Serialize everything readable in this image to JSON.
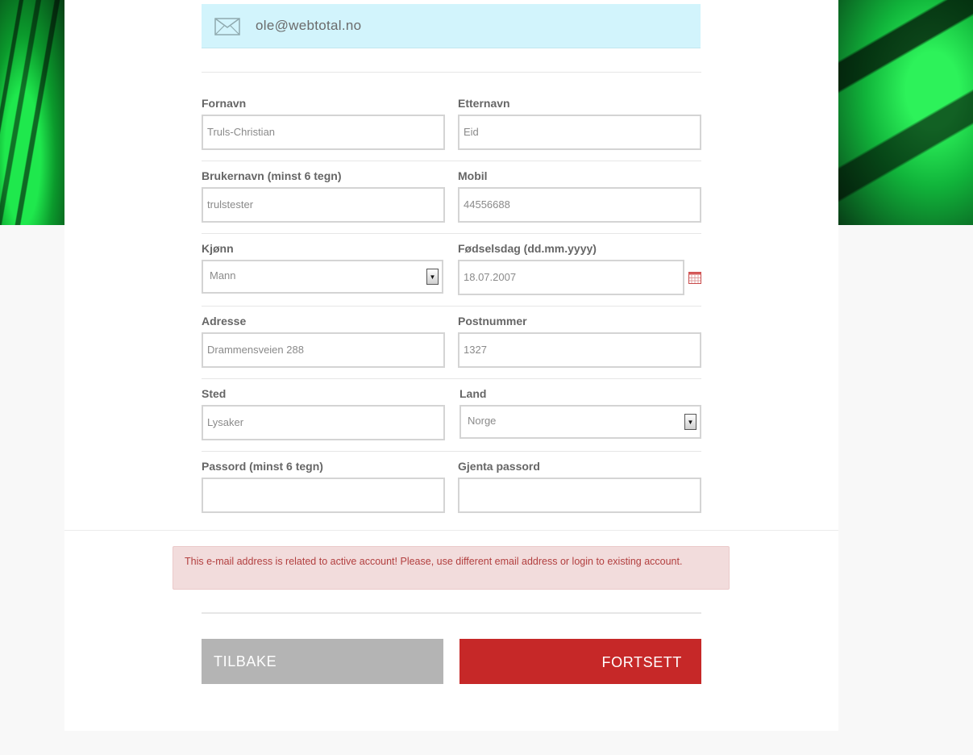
{
  "email": {
    "value": "ole@webtotal.no",
    "icon": "envelope-icon"
  },
  "fields": {
    "fornavn": {
      "label": "Fornavn",
      "value": "Truls-Christian"
    },
    "etternavn": {
      "label": "Etternavn",
      "value": "Eid"
    },
    "brukernavn": {
      "label": "Brukernavn (minst 6 tegn)",
      "value": "trulstester"
    },
    "mobil": {
      "label": "Mobil",
      "value": "44556688"
    },
    "kjonn": {
      "label": "Kjønn",
      "value": "Mann"
    },
    "fodselsdag": {
      "label": "Fødselsdag (dd.mm.yyyy)",
      "value": "18.07.2007"
    },
    "adresse": {
      "label": "Adresse",
      "value": "Drammensveien 288"
    },
    "postnummer": {
      "label": "Postnummer",
      "value": "1327"
    },
    "sted": {
      "label": "Sted",
      "value": "Lysaker"
    },
    "land": {
      "label": "Land",
      "value": "Norge"
    },
    "passord": {
      "label": "Passord (minst 6 tegn)",
      "value": ""
    },
    "gjenta_passord": {
      "label": "Gjenta passord",
      "value": ""
    }
  },
  "error": {
    "message": "This e-mail address is related to active account! Please, use different email address or login to existing account."
  },
  "buttons": {
    "back": "TILBAKE",
    "next": "FORTSETT"
  },
  "colors": {
    "accent": "#c62828",
    "back_button": "#b4b4b4",
    "email_bg": "#d2f4fc",
    "error_bg": "#f2dcdc",
    "error_text": "#b23f3f"
  }
}
